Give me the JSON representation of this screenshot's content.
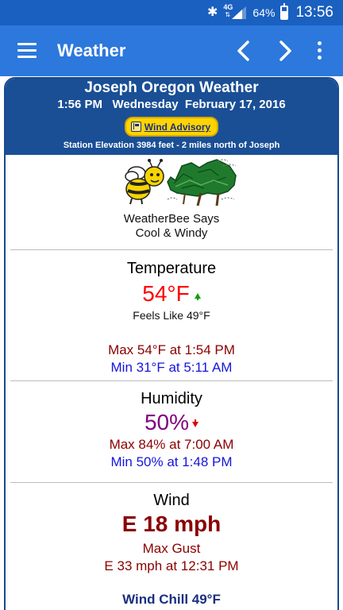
{
  "status_bar": {
    "battery": "64%",
    "battery_level": 0.64,
    "time": "13:56",
    "network": "4G",
    "icons": [
      "bluetooth-icon",
      "network-4g-icon",
      "signal-icon",
      "battery-icon"
    ]
  },
  "app_bar": {
    "title": "Weather",
    "color": "#2c78dc",
    "icons": [
      "menu-icon",
      "chevron-left-icon",
      "chevron-right-icon",
      "more-vert-icon"
    ]
  },
  "header": {
    "station": "Joseph Oregon Weather",
    "datetime": "1:56 PM   Wednesday  February 17, 2016",
    "advisory": "Wind Advisory",
    "elevation": "Station Elevation 3984 feet - 2 miles north of Joseph",
    "color": "#1a4f96"
  },
  "weatherbee": {
    "line1": "WeatherBee Says",
    "line2": "Cool & Windy",
    "icons": [
      "bee-icon",
      "windy-trees-icon"
    ]
  },
  "temperature": {
    "title": "Temperature",
    "value": "54°F",
    "trend": "up",
    "feels_like": "Feels Like 49°F",
    "max": "Max 54°F at 1:54 PM",
    "min": "Min 31°F at 5:11 AM",
    "color": "#ff0000"
  },
  "humidity": {
    "title": "Humidity",
    "value": "50%",
    "trend": "down",
    "max": "Max 84% at 7:00 AM",
    "min": "Min 50% at 1:48 PM",
    "color": "#800080"
  },
  "wind": {
    "title": "Wind",
    "value": "E 18 mph",
    "gust_label": "Max Gust",
    "gust": "E 33 mph at 12:31 PM",
    "wind_chill": "Wind Chill 49°F",
    "color": "#8b0000"
  }
}
